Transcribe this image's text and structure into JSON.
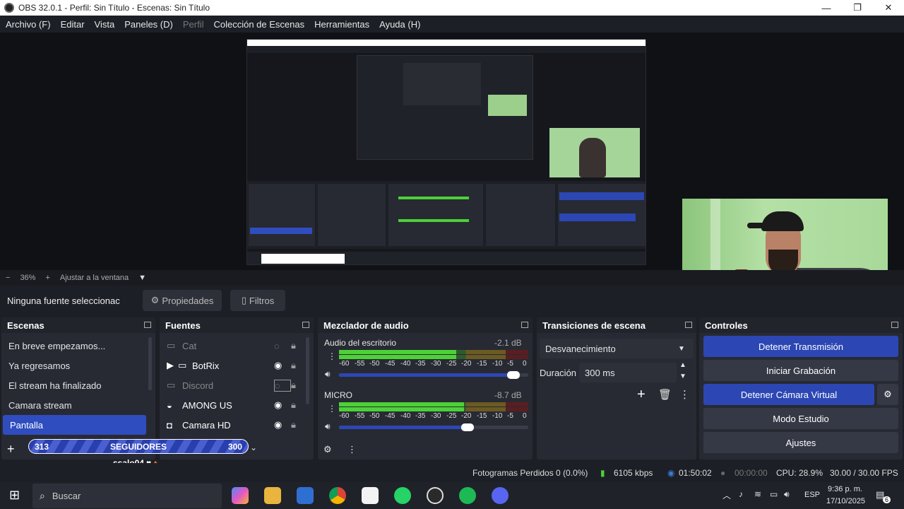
{
  "window": {
    "title": "OBS 32.0.1 - Perfil: Sin Título - Escenas: Sin Título"
  },
  "menu": {
    "items": [
      "Archivo (F)",
      "Editar",
      "Vista",
      "Paneles (D)",
      "Perfil",
      "Colección de Escenas",
      "Herramientas",
      "Ayuda (H)"
    ],
    "disabled_index": 4
  },
  "zoom": {
    "minus": "−",
    "value": "36%",
    "plus": "+",
    "fit_label": "Ajustar a la ventana"
  },
  "properties_bar": {
    "no_source": "Ninguna fuente seleccionac",
    "properties": "Propiedades",
    "filters": "Filtros"
  },
  "scenes": {
    "title": "Escenas",
    "items": [
      "En breve empezamos...",
      "Ya regresamos",
      "El stream ha finalizado",
      "Camara stream",
      "Pantalla"
    ],
    "selected_index": 4
  },
  "sources": {
    "title": "Fuentes",
    "items": [
      {
        "name": "Cat",
        "icon": "display-icon",
        "visible": false
      },
      {
        "name": "BotRix",
        "icon": "folder-icon",
        "visible": true,
        "group": true
      },
      {
        "name": "Discord",
        "icon": "display-icon",
        "visible": false
      },
      {
        "name": "AMONG US",
        "icon": "gamepad-icon",
        "visible": true
      },
      {
        "name": "Camara HD",
        "icon": "camera-icon",
        "visible": true
      }
    ]
  },
  "follower_widget": {
    "current": "313",
    "label": "SEGUIDORES",
    "goal": "300",
    "user": "ssalo04"
  },
  "mixer": {
    "title": "Mezclador de audio",
    "ticks": [
      "-60",
      "-55",
      "-50",
      "-45",
      "-40",
      "-35",
      "-30",
      "-25",
      "-20",
      "-15",
      "-10",
      "-5",
      "0"
    ],
    "channels": [
      {
        "name": "Audio del escritorio",
        "db": "-2.1 dB",
        "level": 0.62,
        "volume": 0.92
      },
      {
        "name": "MICRO",
        "db": "-8.7 dB",
        "level": 0.66,
        "volume": 0.68
      }
    ]
  },
  "transitions": {
    "title": "Transiciones de escena",
    "selected": "Desvanecimiento",
    "duration_label": "Duración",
    "duration_value": "300 ms"
  },
  "controls": {
    "title": "Controles",
    "buttons": [
      "Detener Transmisión",
      "Iniciar Grabación",
      "Detener Cámara Virtual",
      "Modo Estudio",
      "Ajustes"
    ]
  },
  "status": {
    "dropped": "Fotogramas Perdidos 0 (0.0%)",
    "bitrate": "6105 kbps",
    "stream_time": "01:50:02",
    "rec_time": "00:00:00",
    "cpu": "CPU: 28.9%",
    "fps": "30.00 / 30.00 FPS"
  },
  "taskbar": {
    "search_placeholder": "Buscar",
    "lang": "ESP",
    "time": "9:36 p. m.",
    "date": "17/10/2025",
    "notifications": "6"
  },
  "colors": {
    "accent": "#2c47b4",
    "selection": "#2f4dbf",
    "meter_green": "#4cd137",
    "meter_yellow": "#d8b12b",
    "meter_red": "#c2262a"
  }
}
